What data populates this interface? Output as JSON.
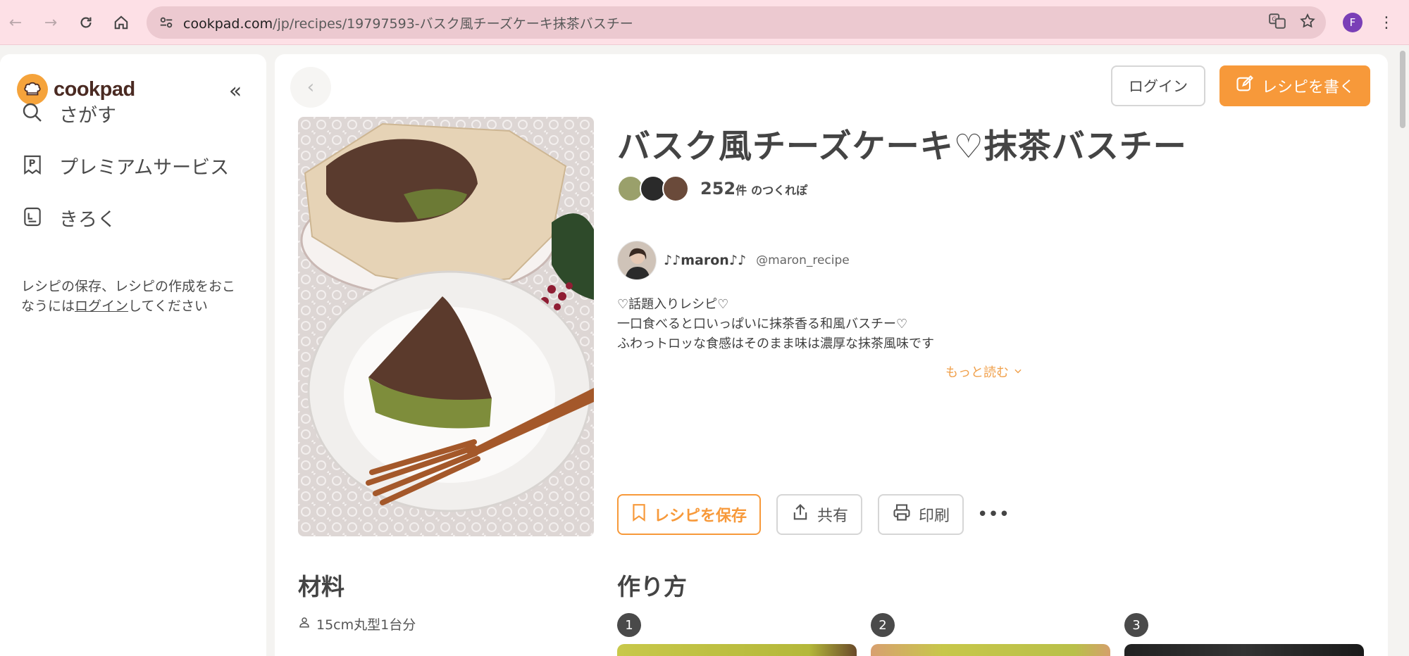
{
  "browser": {
    "url_host": "cookpad.com",
    "url_path": "/jp/recipes/19797593-バスク風チーズケーキ抹茶バスチー",
    "profile_initial": "F"
  },
  "sidebar": {
    "logo": "cookpad",
    "items": [
      {
        "label": "さがす",
        "icon": "search-icon"
      },
      {
        "label": "プレミアムサービス",
        "icon": "premium-icon"
      },
      {
        "label": "きろく",
        "icon": "notebook-icon"
      }
    ],
    "note_prefix": "レシピの保存、レシピの作成をおこなうには",
    "note_link": "ログイン",
    "note_suffix": "してください"
  },
  "header": {
    "login_label": "ログイン",
    "write_label": "レシピを書く"
  },
  "recipe": {
    "title": "バスク風チーズケーキ♡抹茶バスチー",
    "tsukurepo_count": "252",
    "tsukurepo_unit": "件",
    "tsukurepo_suffix": "のつくれぽ",
    "author_name": "♪♪maron♪♪",
    "author_handle": "@maron_recipe",
    "description": [
      "♡話題入りレシピ♡",
      "一口食べると口いっぱいに抹茶香る和風バスチー♡",
      "ふわっトロッな食感はそのまま味は濃厚な抹茶風味です"
    ],
    "more_label": "もっと読む"
  },
  "actions": {
    "save_label": "レシピを保存",
    "share_label": "共有",
    "print_label": "印刷"
  },
  "ingredients": {
    "title": "材料",
    "serving": "15cm丸型1台分"
  },
  "steps": {
    "title": "作り方",
    "numbers": [
      "1",
      "2",
      "3"
    ]
  },
  "colors": {
    "accent": "#f7993a",
    "chrome_bg": "#fde0e6"
  }
}
